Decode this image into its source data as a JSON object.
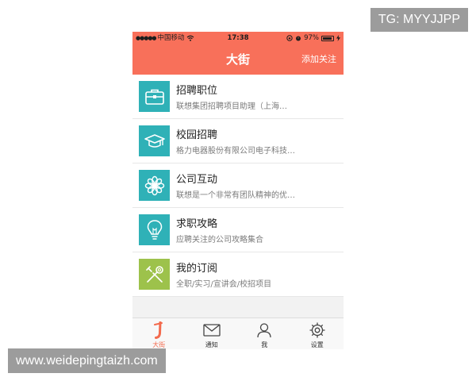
{
  "watermarks": {
    "tg": "TG: MYYJJPP",
    "url": "www.weidepingtaizh.com"
  },
  "status_bar": {
    "carrier": "中国移动",
    "time": "17:38",
    "battery": "97%"
  },
  "nav": {
    "title": "大街",
    "follow_label": "添加关注"
  },
  "menu": [
    {
      "title": "招聘职位",
      "subtitle": "联想集团招聘项目助理（上海…",
      "icon": "briefcase-icon",
      "color": "#2fb1b7"
    },
    {
      "title": "校园招聘",
      "subtitle": "格力电器股份有限公司电子科技…",
      "icon": "graduation-cap-icon",
      "color": "#2fb1b7"
    },
    {
      "title": "公司互动",
      "subtitle": "联想是一个非常有团队精神的优…",
      "icon": "flower-icon",
      "color": "#2fb1b7"
    },
    {
      "title": "求职攻略",
      "subtitle": "应聘关注的公司攻略集合",
      "icon": "lightbulb-icon",
      "color": "#2fb1b7"
    },
    {
      "title": "我的订阅",
      "subtitle": "全职/实习/宣讲会/校招项目",
      "icon": "tools-icon",
      "color": "#9dc24b"
    }
  ],
  "tabs": [
    {
      "label": "大街",
      "icon": "logo-j-icon",
      "active": true
    },
    {
      "label": "通知",
      "icon": "envelope-icon",
      "active": false
    },
    {
      "label": "我",
      "icon": "person-icon",
      "active": false
    },
    {
      "label": "设置",
      "icon": "gear-icon",
      "active": false
    }
  ],
  "colors": {
    "accent": "#f8705a",
    "icon_teal": "#2fb1b7",
    "icon_green": "#9dc24b",
    "tab_active": "#f36a4d"
  }
}
